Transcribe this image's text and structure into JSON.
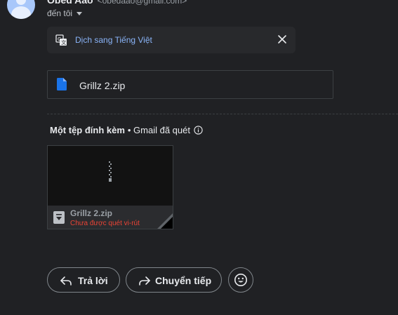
{
  "header": {
    "sender_name": "Obed Aao",
    "sender_email": "<obedaao@gmail.com>",
    "recipient_label": "đến tôi"
  },
  "translate_bar": {
    "link_label": "Dịch sang Tiếng Việt",
    "icon": "translate-icon",
    "close_icon": "close-icon"
  },
  "file_chip": {
    "name": "Grillz 2.zip",
    "icon": "file-icon"
  },
  "attachments": {
    "title": "Một tệp đính kèm",
    "scan_note": "• Gmail đã quét",
    "info_icon": "info-icon",
    "items": [
      {
        "name": "Grillz 2.zip",
        "warning": "Chưa được quét vi-rút",
        "icon": "zip-file-icon"
      }
    ]
  },
  "actions": {
    "reply_label": "Trả lời",
    "forward_label": "Chuyển tiếp",
    "emoji_icon": "emoji-icon"
  },
  "colors": {
    "background": "#202124",
    "link": "#8ab4f8",
    "warning": "#ea4335",
    "border": "#3c4043"
  }
}
